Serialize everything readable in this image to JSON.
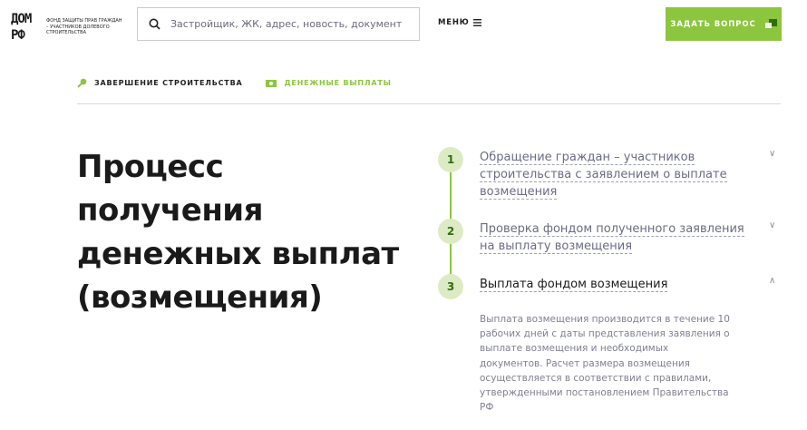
{
  "header": {
    "logo_mark_top": "ДОМ",
    "logo_mark_bottom": "РФ",
    "logo_text": "Фонд защиты прав граждан – участников долевого строительства",
    "search_placeholder": "Застройщик, ЖК, адрес, новость, документ",
    "menu_label": "МЕНЮ",
    "ask_button": "ЗАДАТЬ ВОПРОС"
  },
  "nav": {
    "items": [
      {
        "label": "Завершение строительства",
        "icon": "key-icon"
      },
      {
        "label": "Денежные выплаты",
        "icon": "money-icon",
        "active": true
      }
    ]
  },
  "main": {
    "title": "Процесс получения денежных выплат (возмещения)",
    "steps": [
      {
        "number": "1",
        "label": "Обращение граждан – участников строительства с заявлением о выплате возмещения",
        "expanded": false
      },
      {
        "number": "2",
        "label": "Проверка фондом полученного заявления на выплату возмещения",
        "expanded": false
      },
      {
        "number": "3",
        "label": "Выплата фондом возмещения",
        "expanded": true,
        "description": "Выплата возмещения производится в течение 10 рабочих дней с даты представления заявления о выплате возмещения и необходимых документов. Расчет размера возмещения осуществляется в соответствии с правилами, утвержденными постановлением Правительства РФ"
      }
    ]
  },
  "colors": {
    "accent": "#8cc63f",
    "step_bg": "#dcebc4"
  }
}
